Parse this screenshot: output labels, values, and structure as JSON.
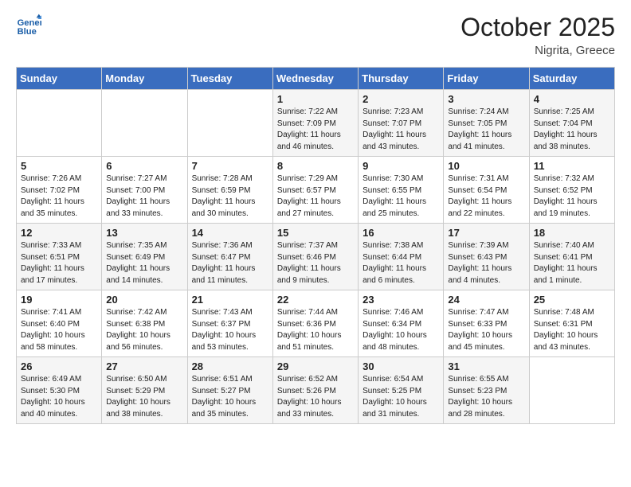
{
  "header": {
    "logo_general": "General",
    "logo_blue": "Blue",
    "month_title": "October 2025",
    "location": "Nigrita, Greece"
  },
  "weekdays": [
    "Sunday",
    "Monday",
    "Tuesday",
    "Wednesday",
    "Thursday",
    "Friday",
    "Saturday"
  ],
  "weeks": [
    [
      {
        "day": "",
        "sunrise": "",
        "sunset": "",
        "daylight": ""
      },
      {
        "day": "",
        "sunrise": "",
        "sunset": "",
        "daylight": ""
      },
      {
        "day": "",
        "sunrise": "",
        "sunset": "",
        "daylight": ""
      },
      {
        "day": "1",
        "sunrise": "Sunrise: 7:22 AM",
        "sunset": "Sunset: 7:09 PM",
        "daylight": "Daylight: 11 hours and 46 minutes."
      },
      {
        "day": "2",
        "sunrise": "Sunrise: 7:23 AM",
        "sunset": "Sunset: 7:07 PM",
        "daylight": "Daylight: 11 hours and 43 minutes."
      },
      {
        "day": "3",
        "sunrise": "Sunrise: 7:24 AM",
        "sunset": "Sunset: 7:05 PM",
        "daylight": "Daylight: 11 hours and 41 minutes."
      },
      {
        "day": "4",
        "sunrise": "Sunrise: 7:25 AM",
        "sunset": "Sunset: 7:04 PM",
        "daylight": "Daylight: 11 hours and 38 minutes."
      }
    ],
    [
      {
        "day": "5",
        "sunrise": "Sunrise: 7:26 AM",
        "sunset": "Sunset: 7:02 PM",
        "daylight": "Daylight: 11 hours and 35 minutes."
      },
      {
        "day": "6",
        "sunrise": "Sunrise: 7:27 AM",
        "sunset": "Sunset: 7:00 PM",
        "daylight": "Daylight: 11 hours and 33 minutes."
      },
      {
        "day": "7",
        "sunrise": "Sunrise: 7:28 AM",
        "sunset": "Sunset: 6:59 PM",
        "daylight": "Daylight: 11 hours and 30 minutes."
      },
      {
        "day": "8",
        "sunrise": "Sunrise: 7:29 AM",
        "sunset": "Sunset: 6:57 PM",
        "daylight": "Daylight: 11 hours and 27 minutes."
      },
      {
        "day": "9",
        "sunrise": "Sunrise: 7:30 AM",
        "sunset": "Sunset: 6:55 PM",
        "daylight": "Daylight: 11 hours and 25 minutes."
      },
      {
        "day": "10",
        "sunrise": "Sunrise: 7:31 AM",
        "sunset": "Sunset: 6:54 PM",
        "daylight": "Daylight: 11 hours and 22 minutes."
      },
      {
        "day": "11",
        "sunrise": "Sunrise: 7:32 AM",
        "sunset": "Sunset: 6:52 PM",
        "daylight": "Daylight: 11 hours and 19 minutes."
      }
    ],
    [
      {
        "day": "12",
        "sunrise": "Sunrise: 7:33 AM",
        "sunset": "Sunset: 6:51 PM",
        "daylight": "Daylight: 11 hours and 17 minutes."
      },
      {
        "day": "13",
        "sunrise": "Sunrise: 7:35 AM",
        "sunset": "Sunset: 6:49 PM",
        "daylight": "Daylight: 11 hours and 14 minutes."
      },
      {
        "day": "14",
        "sunrise": "Sunrise: 7:36 AM",
        "sunset": "Sunset: 6:47 PM",
        "daylight": "Daylight: 11 hours and 11 minutes."
      },
      {
        "day": "15",
        "sunrise": "Sunrise: 7:37 AM",
        "sunset": "Sunset: 6:46 PM",
        "daylight": "Daylight: 11 hours and 9 minutes."
      },
      {
        "day": "16",
        "sunrise": "Sunrise: 7:38 AM",
        "sunset": "Sunset: 6:44 PM",
        "daylight": "Daylight: 11 hours and 6 minutes."
      },
      {
        "day": "17",
        "sunrise": "Sunrise: 7:39 AM",
        "sunset": "Sunset: 6:43 PM",
        "daylight": "Daylight: 11 hours and 4 minutes."
      },
      {
        "day": "18",
        "sunrise": "Sunrise: 7:40 AM",
        "sunset": "Sunset: 6:41 PM",
        "daylight": "Daylight: 11 hours and 1 minute."
      }
    ],
    [
      {
        "day": "19",
        "sunrise": "Sunrise: 7:41 AM",
        "sunset": "Sunset: 6:40 PM",
        "daylight": "Daylight: 10 hours and 58 minutes."
      },
      {
        "day": "20",
        "sunrise": "Sunrise: 7:42 AM",
        "sunset": "Sunset: 6:38 PM",
        "daylight": "Daylight: 10 hours and 56 minutes."
      },
      {
        "day": "21",
        "sunrise": "Sunrise: 7:43 AM",
        "sunset": "Sunset: 6:37 PM",
        "daylight": "Daylight: 10 hours and 53 minutes."
      },
      {
        "day": "22",
        "sunrise": "Sunrise: 7:44 AM",
        "sunset": "Sunset: 6:36 PM",
        "daylight": "Daylight: 10 hours and 51 minutes."
      },
      {
        "day": "23",
        "sunrise": "Sunrise: 7:46 AM",
        "sunset": "Sunset: 6:34 PM",
        "daylight": "Daylight: 10 hours and 48 minutes."
      },
      {
        "day": "24",
        "sunrise": "Sunrise: 7:47 AM",
        "sunset": "Sunset: 6:33 PM",
        "daylight": "Daylight: 10 hours and 45 minutes."
      },
      {
        "day": "25",
        "sunrise": "Sunrise: 7:48 AM",
        "sunset": "Sunset: 6:31 PM",
        "daylight": "Daylight: 10 hours and 43 minutes."
      }
    ],
    [
      {
        "day": "26",
        "sunrise": "Sunrise: 6:49 AM",
        "sunset": "Sunset: 5:30 PM",
        "daylight": "Daylight: 10 hours and 40 minutes."
      },
      {
        "day": "27",
        "sunrise": "Sunrise: 6:50 AM",
        "sunset": "Sunset: 5:29 PM",
        "daylight": "Daylight: 10 hours and 38 minutes."
      },
      {
        "day": "28",
        "sunrise": "Sunrise: 6:51 AM",
        "sunset": "Sunset: 5:27 PM",
        "daylight": "Daylight: 10 hours and 35 minutes."
      },
      {
        "day": "29",
        "sunrise": "Sunrise: 6:52 AM",
        "sunset": "Sunset: 5:26 PM",
        "daylight": "Daylight: 10 hours and 33 minutes."
      },
      {
        "day": "30",
        "sunrise": "Sunrise: 6:54 AM",
        "sunset": "Sunset: 5:25 PM",
        "daylight": "Daylight: 10 hours and 31 minutes."
      },
      {
        "day": "31",
        "sunrise": "Sunrise: 6:55 AM",
        "sunset": "Sunset: 5:23 PM",
        "daylight": "Daylight: 10 hours and 28 minutes."
      },
      {
        "day": "",
        "sunrise": "",
        "sunset": "",
        "daylight": ""
      }
    ]
  ]
}
